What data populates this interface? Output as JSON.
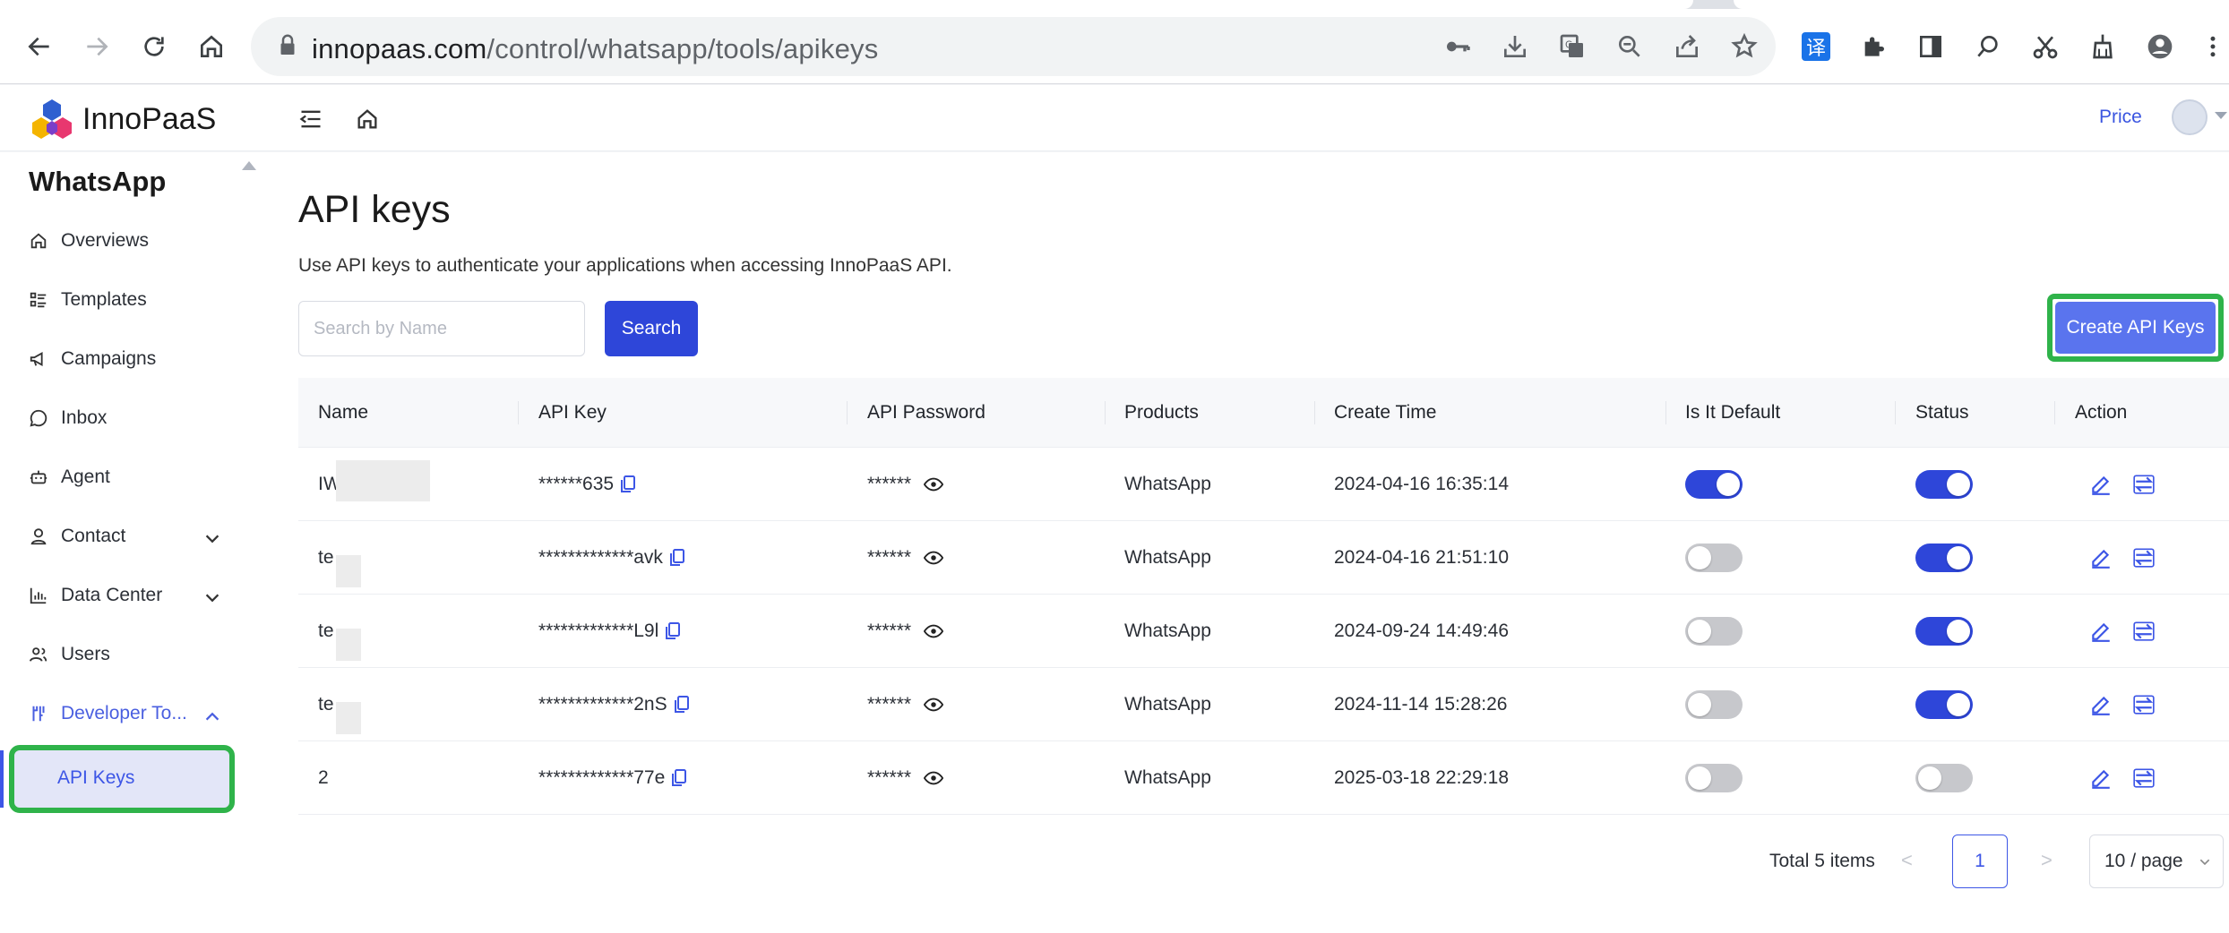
{
  "browser": {
    "url_host": "innopaas.com",
    "url_path": "/control/whatsapp/tools/apikeys",
    "translate_label": "译"
  },
  "header": {
    "logo_text": "InnoPaaS",
    "price_label": "Price"
  },
  "sidebar": {
    "title": "WhatsApp",
    "items": [
      {
        "label": "Overviews",
        "icon": "home-icon"
      },
      {
        "label": "Templates",
        "icon": "list-icon"
      },
      {
        "label": "Campaigns",
        "icon": "megaphone-icon"
      },
      {
        "label": "Inbox",
        "icon": "chat-icon"
      },
      {
        "label": "Agent",
        "icon": "robot-icon"
      },
      {
        "label": "Contact",
        "icon": "user-icon"
      },
      {
        "label": "Data Center",
        "icon": "chart-icon"
      },
      {
        "label": "Users",
        "icon": "users-icon"
      },
      {
        "label": "Developer To...",
        "icon": "tools-icon"
      }
    ],
    "sub_active": "API Keys"
  },
  "main": {
    "title": "API keys",
    "description": "Use API keys to authenticate your applications when accessing InnoPaaS API.",
    "search_placeholder": "Search by Name",
    "search_button": "Search",
    "create_button": "Create API Keys"
  },
  "table": {
    "columns": [
      "Name",
      "API Key",
      "API Password",
      "Products",
      "Create Time",
      "Is It Default",
      "Status",
      "Action"
    ],
    "rows": [
      {
        "name": "IW",
        "api_key": "******635",
        "api_password": "******",
        "product": "WhatsApp",
        "create_time": "2024-04-16 16:35:14",
        "is_default": true,
        "status": true
      },
      {
        "name": "te",
        "api_key": "*************avk",
        "api_password": "******",
        "product": "WhatsApp",
        "create_time": "2024-04-16 21:51:10",
        "is_default": false,
        "status": true
      },
      {
        "name": "te",
        "api_key": "*************L9l",
        "api_password": "******",
        "product": "WhatsApp",
        "create_time": "2024-09-24 14:49:46",
        "is_default": false,
        "status": true
      },
      {
        "name": "te",
        "api_key": "*************2nS",
        "api_password": "******",
        "product": "WhatsApp",
        "create_time": "2024-11-14 15:28:26",
        "is_default": false,
        "status": true
      },
      {
        "name": "2",
        "api_key": "*************77e",
        "api_password": "******",
        "product": "WhatsApp",
        "create_time": "2025-03-18 22:29:18",
        "is_default": false,
        "status": false
      }
    ]
  },
  "pagination": {
    "total": "Total 5 items",
    "current_page": "1",
    "page_size": "10 / page",
    "prev": "<",
    "next": ">"
  },
  "colors": {
    "primary": "#2e46d9",
    "create_button": "#5a74ee",
    "highlight": "#2fb34a",
    "toggle_off": "#c7c8cc"
  }
}
